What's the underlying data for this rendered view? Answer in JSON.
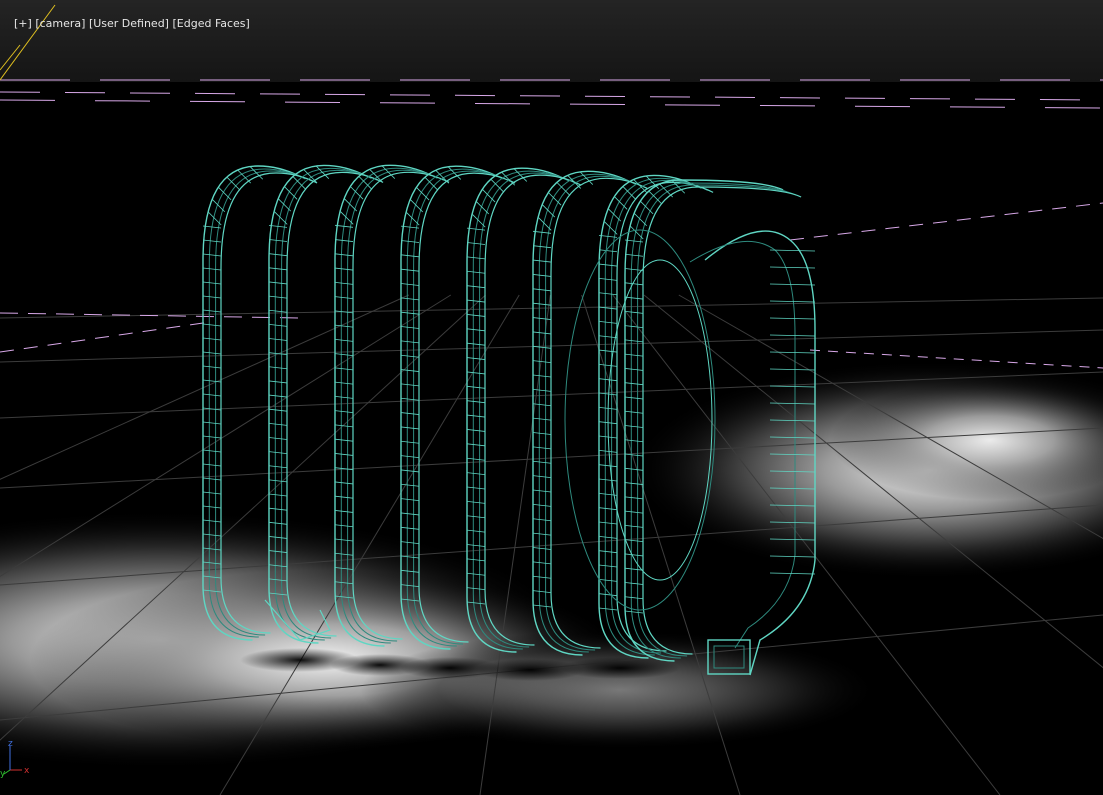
{
  "viewport": {
    "label_items": [
      "[+]",
      "[camera]",
      "[User Defined]",
      "[Edged Faces]"
    ],
    "axis_labels": {
      "x": "x",
      "y": "y",
      "z": "z"
    },
    "colors": {
      "background_top": "#202020",
      "floor": "#1a1a1a",
      "grid_line": "#3c3c3c",
      "wire": "#5fd6c3",
      "wire_dark": "#2e8a7e",
      "light_line": "#d8a8e8",
      "camera_line": "#e0c020",
      "axis_x": "#d03030",
      "axis_y": "#30c030",
      "axis_z": "#4070e0"
    },
    "object": {
      "name": "spring-coil",
      "coils": 8
    }
  }
}
